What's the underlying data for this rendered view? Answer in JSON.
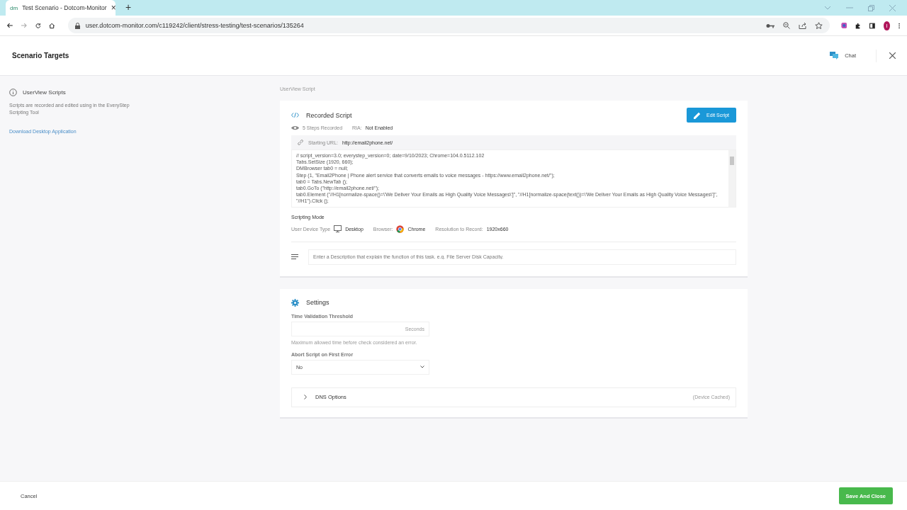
{
  "browser": {
    "tab": {
      "favicon": "dm",
      "title": "Test Scenario - Dotcom-Monitor",
      "close": "×"
    },
    "new_tab": "+",
    "url": "user.dotcom-monitor.com/c119242/client/stress-testing/test-scenarios/135264",
    "profile": "I"
  },
  "header": {
    "title": "Scenario Targets",
    "chat": "Chat"
  },
  "sidebar": {
    "title": "UserView Scripts",
    "text": "Scripts are recorded and edited using in the EveryStep Scripting Tool",
    "link": "Download Desktop Application"
  },
  "section_label": "UserView Script",
  "recorded": {
    "title": "Recorded Script",
    "edit_button": "Edit Script",
    "steps": "5 Steps Recorded",
    "ria_label": "RIA:",
    "ria_value": "Not Enabled",
    "url_label": "Starting URL:",
    "url": "http://email2phone.net/",
    "script_lines": [
      "// script_version=3.0; everystep_version=0; date=9/10/2023; Chrome=104.0.5112.102",
      "Tabs.SetSize (1920, 660);",
      "DMBrowser tab0 = null;",
      "Step (1, \"Email2Phone | Phone alert service that converts emails to voice messages - https://www.email2phone.net/\");",
      "tab0 = Tabs.NewTab ();",
      "tab0.GoTo (\"http://email2phone.net/\");",
      "tab0.Element (\"//H1[normalize-space()=\\'We Deliver Your Emails as High Quality Voice Messages\\']\", \"//H1[normalize-space(text())=\\'We Deliver Your Emails as High Quality Voice Messages\\']\", \"//H1\").Click ();"
    ]
  },
  "scripting_mode": {
    "title": "Scripting Mode",
    "device_label": "User Device Type",
    "device": "Desktop",
    "browser_label": "Browser:",
    "browser": "Chrome",
    "resolution_label": "Resolution to Record:",
    "resolution": "1920x660"
  },
  "description": {
    "placeholder": "Enter a Description that explain the function of this task. e.g. File Server Disk Capacity."
  },
  "settings": {
    "title": "Settings",
    "threshold_label": "Time Validation Threshold",
    "threshold_unit": "Seconds",
    "threshold_hint": "Maximum allowed time before check considered an error.",
    "abort_label": "Abort Script on First Error",
    "abort_value": "No",
    "dns": {
      "title": "DNS Options",
      "note": "(Device Cached)",
      "expanded": false
    }
  },
  "footer": {
    "cancel": "Cancel",
    "save": "Save And Close"
  }
}
